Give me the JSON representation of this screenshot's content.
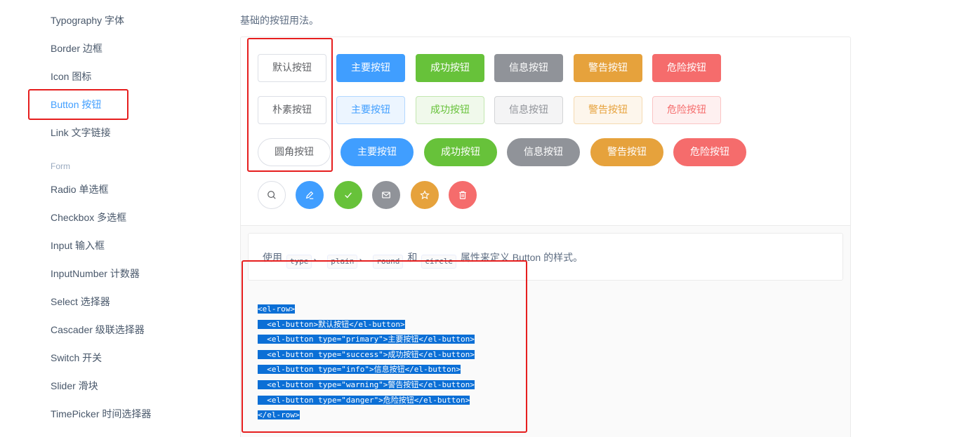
{
  "sidebar": {
    "items": [
      {
        "label": "Typography 字体"
      },
      {
        "label": "Border 边框"
      },
      {
        "label": "Icon 图标"
      },
      {
        "label": "Button 按钮"
      },
      {
        "label": "Link 文字链接"
      }
    ],
    "group_label": "Form",
    "form_items": [
      {
        "label": "Radio 单选框"
      },
      {
        "label": "Checkbox 多选框"
      },
      {
        "label": "Input 输入框"
      },
      {
        "label": "InputNumber 计数器"
      },
      {
        "label": "Select 选择器"
      },
      {
        "label": "Cascader 级联选择器"
      },
      {
        "label": "Switch 开关"
      },
      {
        "label": "Slider 滑块"
      },
      {
        "label": "TimePicker 时间选择器"
      }
    ]
  },
  "intro": "基础的按钮用法。",
  "buttons": {
    "row1": [
      "默认按钮",
      "主要按钮",
      "成功按钮",
      "信息按钮",
      "警告按钮",
      "危险按钮"
    ],
    "row2": [
      "朴素按钮",
      "主要按钮",
      "成功按钮",
      "信息按钮",
      "警告按钮",
      "危险按钮"
    ],
    "row3": [
      "圆角按钮",
      "主要按钮",
      "成功按钮",
      "信息按钮",
      "警告按钮",
      "危险按钮"
    ],
    "icons": [
      "search-icon",
      "edit-icon",
      "check-icon",
      "message-icon",
      "star-icon",
      "delete-icon"
    ]
  },
  "description": {
    "prefix": "使用",
    "tags": [
      "type",
      "plain",
      "round",
      "circle"
    ],
    "sep": "、",
    "and": "和",
    "suffix": "属性来定义 Button 的样式。"
  },
  "code_lines": [
    "<el-row>",
    "  <el-button>默认按钮</el-button>",
    "  <el-button type=\"primary\">主要按钮</el-button>",
    "  <el-button type=\"success\">成功按钮</el-button>",
    "  <el-button type=\"info\">信息按钮</el-button>",
    "  <el-button type=\"warning\">警告按钮</el-button>",
    "  <el-button type=\"danger\">危险按钮</el-button>",
    "</el-row>"
  ],
  "colors": {
    "primary": "#409eff",
    "success": "#67c23a",
    "info": "#909399",
    "warning": "#e6a23c",
    "danger": "#f56c6c",
    "highlight": "#e61e1e",
    "selection": "#0b6fd6"
  }
}
